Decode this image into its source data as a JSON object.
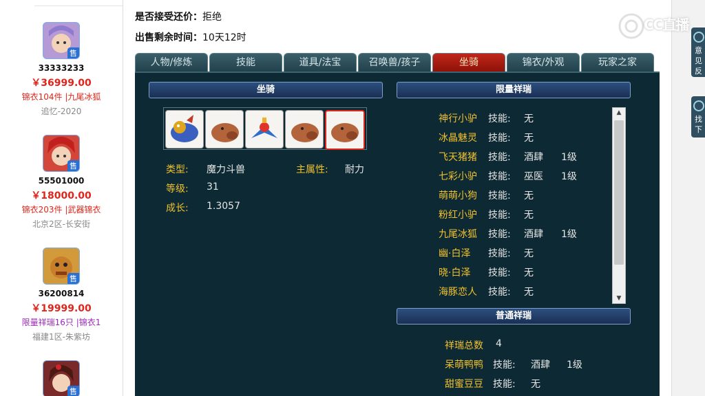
{
  "listings": [
    {
      "id": "33333233",
      "price": "￥36999.00",
      "tags": "锦衣104件 |九尾冰狐",
      "tags_color": "#e0251b",
      "server": "追忆-2020",
      "avatar_color": "#b59ad6"
    },
    {
      "id": "55501000",
      "price": "￥18000.00",
      "tags": "锦衣203件 |武器锦衣",
      "tags_color": "#e0251b",
      "server": "北京2区-长安街",
      "avatar_color": "#d2473a"
    },
    {
      "id": "36200814",
      "price": "￥19999.00",
      "tags": "限量祥瑞16只 |锦衣1",
      "tags_color": "#9b2ab8",
      "server": "福建1区-朱紫坊",
      "avatar_color": "#d29a3a"
    },
    {
      "id": "",
      "price": "",
      "tags": "",
      "tags_color": "#e0251b",
      "server": "",
      "avatar_color": "#7a2a2a"
    }
  ],
  "listing_badge": "售",
  "info": {
    "accept_label": "是否接受还价：",
    "accept_value": "拒绝",
    "remain_label": "出售剩余时间：",
    "remain_value": "10天12时"
  },
  "tabs": [
    "人物/修炼",
    "技能",
    "道具/法宝",
    "召唤兽/孩子",
    "坐骑",
    "锦衣/外观",
    "玩家之家"
  ],
  "active_tab": 4,
  "mount_section": {
    "title": "坐骑",
    "type_label": "类型:",
    "type_value": "魔力斗兽",
    "main_label": "主属性:",
    "main_value": "耐力",
    "level_label": "等级:",
    "level_value": "31",
    "growth_label": "成长:",
    "growth_value": "1.3057"
  },
  "limited": {
    "title": "限量祥瑞",
    "skill_label": "技能:",
    "items": [
      {
        "name": "神行小驴",
        "skill": "无",
        "level": ""
      },
      {
        "name": "冰晶魅灵",
        "skill": "无",
        "level": ""
      },
      {
        "name": "飞天猪猪",
        "skill": "酒肆",
        "level": "1级"
      },
      {
        "name": "七彩小驴",
        "skill": "巫医",
        "level": "1级"
      },
      {
        "name": "萌萌小狗",
        "skill": "无",
        "level": ""
      },
      {
        "name": "粉红小驴",
        "skill": "无",
        "level": ""
      },
      {
        "name": "九尾冰狐",
        "skill": "酒肆",
        "level": "1级"
      },
      {
        "name": "幽·白泽",
        "skill": "无",
        "level": ""
      },
      {
        "name": "晓·白泽",
        "skill": "无",
        "level": ""
      },
      {
        "name": "海豚恋人",
        "skill": "无",
        "level": ""
      }
    ]
  },
  "common": {
    "title": "普通祥瑞",
    "total_label": "祥瑞总数",
    "total_value": "4",
    "skill_label": "技能:",
    "items": [
      {
        "name": "呆萌鸭鸭",
        "skill": "酒肆",
        "level": "1级"
      },
      {
        "name": "甜蜜豆豆",
        "skill": "无",
        "level": ""
      }
    ]
  },
  "side_tabs": [
    {
      "text": "意见反"
    },
    {
      "text": "找下"
    }
  ],
  "watermark": "CC直播",
  "colors": {
    "gold": "#f1c12d",
    "price_red": "#e0251b",
    "panel": "#0d2933",
    "active_tab": "#c0261a"
  }
}
